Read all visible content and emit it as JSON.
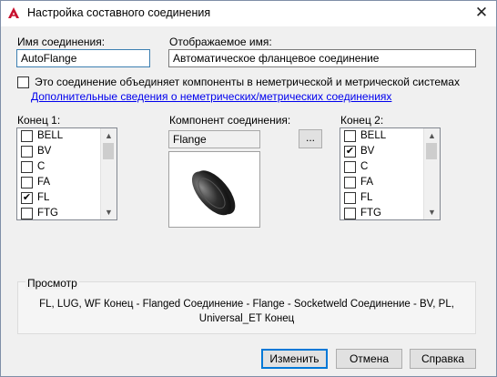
{
  "window": {
    "title": "Настройка составного соединения",
    "close_glyph": "✕",
    "app_icon": "autocad-icon"
  },
  "connection_name": {
    "label": "Имя соединения:",
    "value": "AutoFlange"
  },
  "display_name": {
    "label": "Отображаемое имя:",
    "value": "Автоматическое фланцевое соединение"
  },
  "mixed_units": {
    "checked": false,
    "label": "Это соединение объединяет компоненты в неметрической и метрической системах",
    "link": "Дополнительные сведения о неметрических/метрических соединениях"
  },
  "end1": {
    "label": "Конец 1:",
    "items": [
      {
        "name": "BELL",
        "checked": false
      },
      {
        "name": "BV",
        "checked": false
      },
      {
        "name": "C",
        "checked": false
      },
      {
        "name": "FA",
        "checked": false
      },
      {
        "name": "FL",
        "checked": true
      },
      {
        "name": "FTG",
        "checked": false
      }
    ]
  },
  "component": {
    "label": "Компонент соединения:",
    "value": "Flange",
    "browse_label": "...",
    "preview_icon": "flange-icon"
  },
  "end2": {
    "label": "Конец 2:",
    "items": [
      {
        "name": "BELL",
        "checked": false
      },
      {
        "name": "BV",
        "checked": true
      },
      {
        "name": "C",
        "checked": false
      },
      {
        "name": "FA",
        "checked": false
      },
      {
        "name": "FL",
        "checked": false
      },
      {
        "name": "FTG",
        "checked": false
      }
    ]
  },
  "preview": {
    "label": "Просмотр",
    "line1": "FL, LUG, WF Конец - Flanged Соединение - Flange - Socketweld Соединение - BV, PL,",
    "line2": "Universal_ET Конец"
  },
  "buttons": {
    "modify": "Изменить",
    "cancel": "Отмена",
    "help": "Справка"
  },
  "colors": {
    "link": "#0000ee",
    "focus_border": "#3c7fb1",
    "default_button": "#0078d7",
    "app_icon_red": "#c8102e"
  }
}
